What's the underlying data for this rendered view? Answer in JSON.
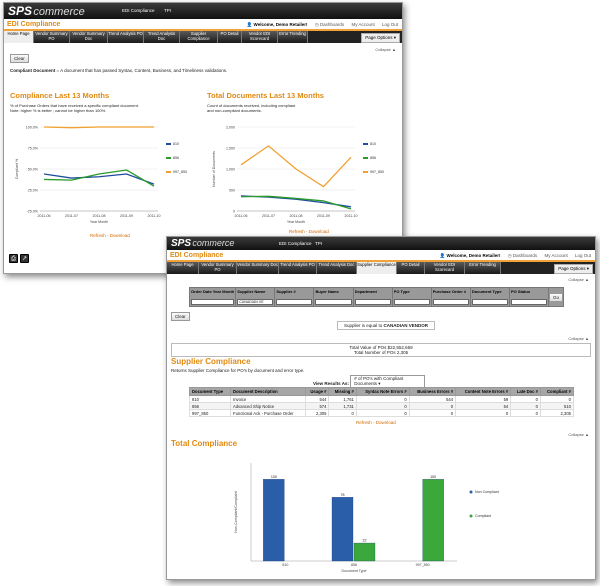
{
  "brand": {
    "sps": "SPS",
    "commerce": "commerce"
  },
  "app_title": "EDI Compliance",
  "top_links": [
    "EDI Compliance",
    "TPI"
  ],
  "user": {
    "welcome": "Welcome, Demo Retailer!",
    "dashboards": "Dashboards",
    "my_account": "My Account",
    "logout": "Log Out"
  },
  "tabs": [
    "Home Page",
    "Vendor Summary PO",
    "Vendor Summary Doc",
    "Trend Analysis PO",
    "Trend Analysis Doc",
    "Supplier Compliance",
    "PO Detail",
    "Vendor EDI Scorecard",
    "Error Trending"
  ],
  "page_options": "Page Options",
  "collapse": "Collapse",
  "clear": "Clear",
  "win1": {
    "definition_term": "Compliant Document",
    "definition_text": "= A document that has passed Syntax, Content, Business, and Timeliness validations.",
    "left_title": "Compliance Last 13 Months",
    "left_desc1": "% of Purchase Orders that have received a specific compliant document.",
    "left_desc2": "Note: higher % is better ; cannot be higher than 100%.",
    "right_title": "Total Documents Last 13 Months",
    "right_desc1": "Count of documents received, including compliant",
    "right_desc2": "and non-compliant documents.",
    "refresh": "Refresh",
    "download": "Download",
    "sep": " - "
  },
  "chart_left": {
    "type": "line",
    "x": [
      "2011-06",
      "2011-07",
      "2011-08",
      "2011-09",
      "2011-10"
    ],
    "y_ticks": [
      "100.0%",
      "75.0%",
      "50.0%",
      "25.0%",
      "-25.0%"
    ],
    "ylabel": "Compliant %",
    "xlabel": "Year Month",
    "series": [
      {
        "name": "810",
        "color": "#1f4e9c",
        "values": [
          30,
          24,
          26,
          30,
          15
        ]
      },
      {
        "name": "856",
        "color": "#2a9a2a",
        "values": [
          22,
          21,
          30,
          36,
          12
        ]
      },
      {
        "name": "997_850",
        "color": "#f0a030",
        "values": [
          100,
          99,
          100,
          100,
          100
        ]
      }
    ]
  },
  "chart_right": {
    "type": "line",
    "x": [
      "2011-06",
      "2011-07",
      "2011-08",
      "2011-09",
      "2011-10"
    ],
    "y_ticks": [
      "2,000",
      "1,500",
      "1,000",
      "500",
      "0"
    ],
    "ylabel": "Number of Documents",
    "xlabel": "Year Month",
    "series": [
      {
        "name": "810",
        "color": "#1f4e9c",
        "values": [
          360,
          330,
          280,
          200,
          100
        ]
      },
      {
        "name": "856",
        "color": "#2a9a2a",
        "values": [
          340,
          350,
          300,
          240,
          50
        ]
      },
      {
        "name": "997_850",
        "color": "#f0a030",
        "values": [
          1100,
          1550,
          1000,
          580,
          1280
        ]
      }
    ]
  },
  "win2": {
    "filter_headers": [
      "Order Date Year Month",
      "Supplier Name",
      "Supplier #",
      "Buyer Name",
      "Department",
      "PO Type",
      "Purchase Order #",
      "Document Type",
      "PO Status"
    ],
    "filter_supplier_value": "CANADIAN VE",
    "go": "Go",
    "filter_note_prefix": "Supplier is equal to ",
    "filter_note_value": "CANADIAN VENDOR",
    "total_value": "Total Value of POs $22,552,659",
    "total_count": "Total Number of POs 2,305",
    "supplier_title": "Supplier Compliance",
    "supplier_desc": "Returns Supplier Compliance for PO's by document and error type.",
    "view_label": "View Results As:",
    "view_value": "# of PO's with Compliant Documents",
    "table_headers": [
      "Document Type",
      "Document Description",
      "Usage #",
      "Missing #",
      "Syntax Note Errors #",
      "Business Errors #",
      "Content Note Errors #",
      "Late Doc #",
      "Compliant #"
    ],
    "table_rows": [
      [
        "810",
        "Invoice",
        "544",
        "1,761",
        "0",
        "544",
        "59",
        "0",
        "0"
      ],
      [
        "856",
        "Advanced Ship Notice",
        "574",
        "1,731",
        "0",
        "0",
        "64",
        "0",
        "510"
      ],
      [
        "997_850",
        "Functional Ack - Purchase Order",
        "2,305",
        "0",
        "0",
        "0",
        "0",
        "0",
        "2,305"
      ]
    ],
    "refresh": "Refresh",
    "download": "Download",
    "sep": " - ",
    "total_title": "Total Compliance"
  },
  "chart_bottom": {
    "type": "bar",
    "categories": [
      "810",
      "856",
      "997_850"
    ],
    "ylabel": "Non-Compliant/Compliant",
    "xlabel": "Document Type",
    "series": [
      {
        "name": "Non Compliant",
        "color": "#2a5ea8",
        "values": [
          100,
          78,
          0
        ]
      },
      {
        "name": "Compliant",
        "color": "#3aa83a",
        "values": [
          0,
          22,
          100
        ]
      }
    ],
    "data_labels": [
      "100",
      "78",
      "22",
      "100"
    ],
    "ylim": [
      0,
      120
    ]
  }
}
